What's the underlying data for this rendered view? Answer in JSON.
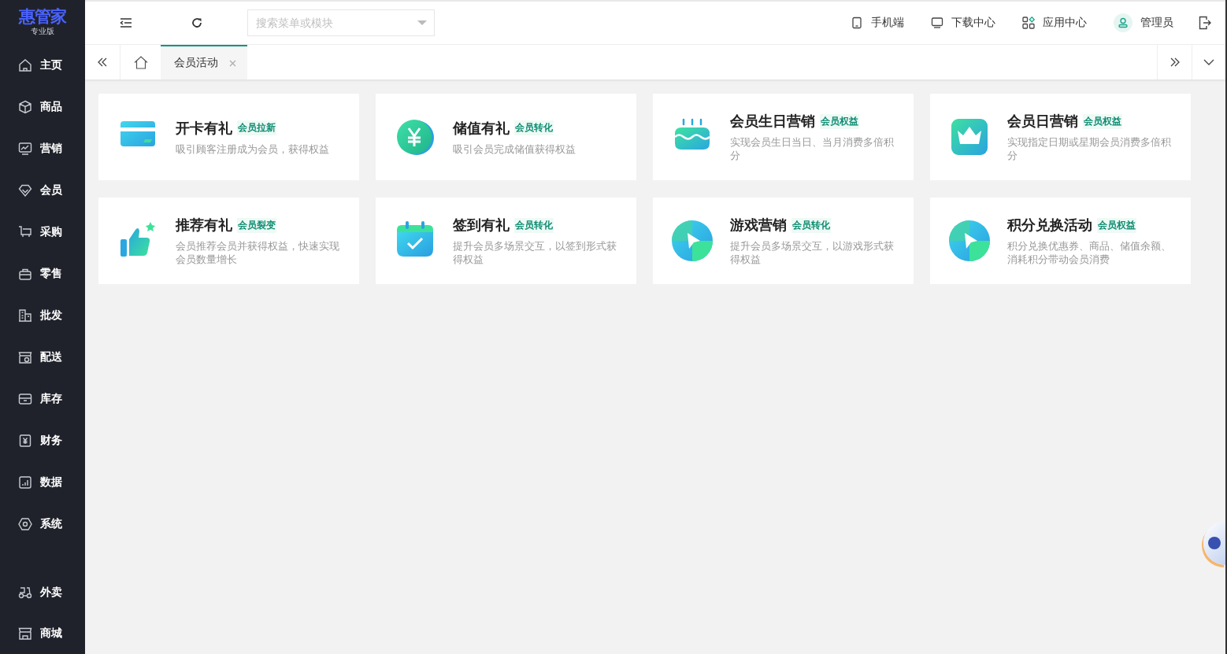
{
  "brand": {
    "name": "惠管家",
    "edition": "专业版"
  },
  "sidebar": {
    "items": [
      {
        "label": "主页"
      },
      {
        "label": "商品"
      },
      {
        "label": "营销"
      },
      {
        "label": "会员"
      },
      {
        "label": "采购"
      },
      {
        "label": "零售"
      },
      {
        "label": "批发"
      },
      {
        "label": "配送"
      },
      {
        "label": "库存"
      },
      {
        "label": "财务"
      },
      {
        "label": "数据"
      },
      {
        "label": "系统"
      }
    ],
    "bottom_items": [
      {
        "label": "外卖"
      },
      {
        "label": "商城"
      }
    ]
  },
  "header": {
    "search": {
      "placeholder": "搜索菜单或模块"
    },
    "links": [
      {
        "label": "手机端"
      },
      {
        "label": "下载中心"
      },
      {
        "label": "应用中心"
      }
    ],
    "user": {
      "name": "管理员"
    }
  },
  "tabs": [
    {
      "label": "会员活动",
      "selected": true
    }
  ],
  "cards": [
    {
      "kind": "card",
      "title": "开卡有礼",
      "tag": "会员拉新",
      "description": "吸引顾客注册成为会员，获得权益"
    },
    {
      "kind": "yen",
      "title": "储值有礼",
      "tag": "会员转化",
      "description": "吸引会员完成储值获得权益"
    },
    {
      "kind": "cake",
      "title": "会员生日营销",
      "tag": "会员权益",
      "description": "实现会员生日当日、当月消费多倍积分"
    },
    {
      "kind": "crown",
      "title": "会员日营销",
      "tag": "会员权益",
      "description": "实现指定日期或星期会员消费多倍积分"
    },
    {
      "kind": "thumb",
      "title": "推荐有礼",
      "tag": "会员裂变",
      "description": "会员推荐会员并获得权益，快速实现会员数量增长"
    },
    {
      "kind": "calendar",
      "title": "签到有礼",
      "tag": "会员转化",
      "description": "提升会员多场景交互，以签到形式获得权益"
    },
    {
      "kind": "play",
      "title": "游戏营销",
      "tag": "会员转化",
      "description": "提升会员多场景交互，以游戏形式获得权益"
    },
    {
      "kind": "play",
      "title": "积分兑换活动",
      "tag": "会员权益",
      "description": "积分兑换优惠券、商品、储值余额、消耗积分带动会员消费"
    }
  ]
}
